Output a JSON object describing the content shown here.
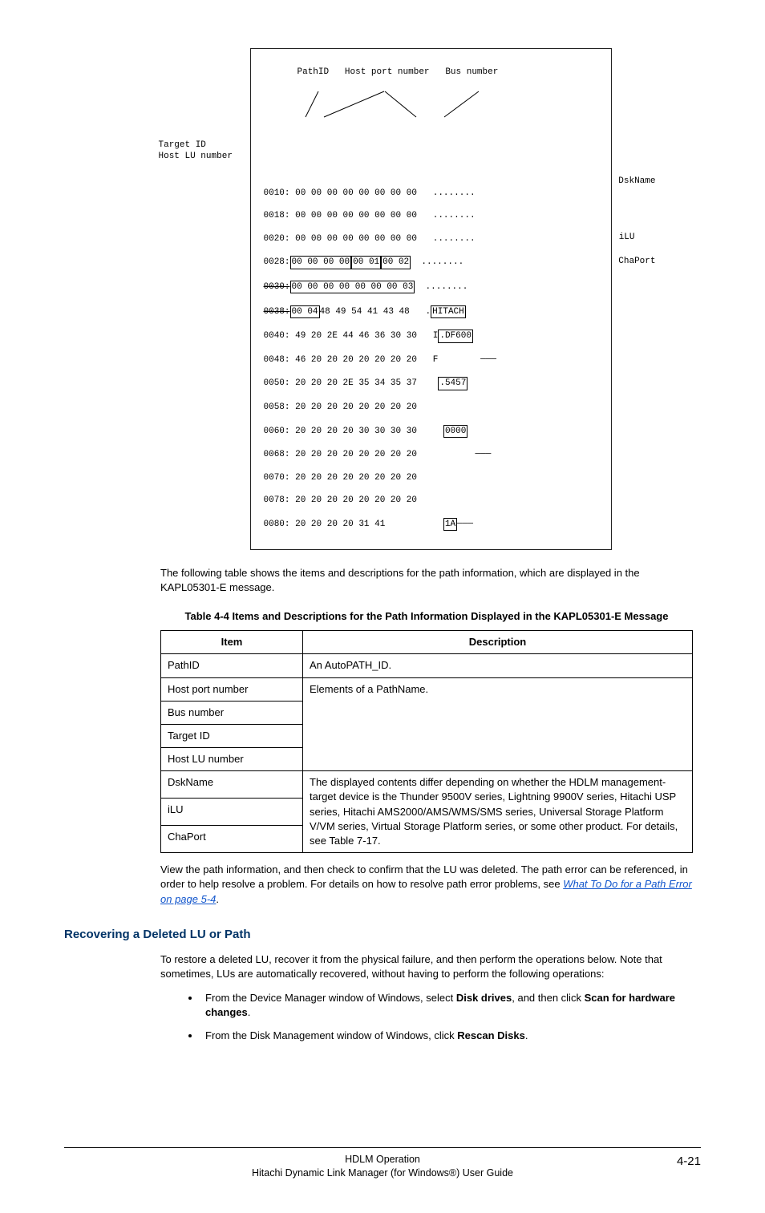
{
  "figure": {
    "labels_top": "PathID   Host port number   Bus number",
    "left_label1": "Target ID",
    "left_label2": "Host LU number",
    "right_label1": "DskName",
    "right_label2": "iLU",
    "right_label3": "ChaPort",
    "rows": [
      "0010: 00 00 00 00 00 00 00 00   ........",
      "0018: 00 00 00 00 00 00 00 00   ........",
      "0020: 00 00 00 00 00 00 00 00   ........",
      "0028: 00 00 00 00 00 01 00 02   ........",
      "0030: 00 00 00 00 00 00 00 03   ........",
      "0038: 00 04 48 49 54 41 43 48   ..HITACH",
      "0040: 49 20 2E 44 46 36 30 30   I .DF600",
      "0048: 46 20 20 20 20 20 20 20   F",
      "0050: 20 20 20 2E 35 34 35 37    .5457",
      "0058: 20 20 20 20 20 20 20 20",
      "0060: 20 20 20 20 30 30 30 30     0000",
      "0068: 20 20 20 20 20 20 20 20",
      "0070: 20 20 20 20 20 20 20 20",
      "0078: 20 20 20 20 20 20 20 20",
      "0080: 20 20 20 20 31 41           1A"
    ]
  },
  "intro_para": "The following table shows the items and descriptions for the path information, which are displayed in the KAPL05301-E message.",
  "table_caption": "Table 4-4 Items and Descriptions for the Path Information Displayed in the KAPL05301-E Message",
  "table": {
    "headers": [
      "Item",
      "Description"
    ],
    "rows": [
      {
        "item": "PathID",
        "desc": "An AutoPATH_ID."
      },
      {
        "item": "Host port number",
        "desc": "Elements of a PathName.",
        "rowspan": 4
      },
      {
        "item": "Bus number"
      },
      {
        "item": "Target ID"
      },
      {
        "item": "Host LU number"
      },
      {
        "item": "DskName",
        "desc": "The displayed contents differ depending on whether the HDLM management-target device is the Thunder 9500V series, Lightning 9900V series, Hitachi USP series, Hitachi AMS2000/AMS/WMS/SMS series, Universal Storage Platform V/VM series, Virtual Storage Platform series, or some other product. For details, see Table 7-17.",
        "rowspan": 3
      },
      {
        "item": "iLU"
      },
      {
        "item": "ChaPort"
      }
    ]
  },
  "para_after_table_prefix": "View the path information, and then check to confirm that the LU was deleted. The path error can be referenced, in order to help resolve a problem. For details on how to resolve path error problems, see ",
  "link_text": "What To Do for a Path Error on page 5-4",
  "para_after_table_suffix": ".",
  "h2": "Recovering a Deleted LU or Path",
  "recover_intro": "To restore a deleted LU, recover it from the physical failure, and then perform the operations below. Note that sometimes, LUs are automatically recovered, without having to perform the following operations:",
  "bullets": [
    {
      "pre": "From the Device Manager window of Windows, select ",
      "b1": "Disk drives",
      "mid": ", and then click ",
      "b2": "Scan for hardware changes",
      "post": "."
    },
    {
      "pre": "From the Disk Management window of Windows, click ",
      "b1": "Rescan Disks",
      "mid": "",
      "b2": "",
      "post": "."
    }
  ],
  "footer": {
    "line1": "HDLM Operation",
    "line2": "Hitachi Dynamic Link Manager (for Windows®) User Guide",
    "page": "4-21"
  }
}
